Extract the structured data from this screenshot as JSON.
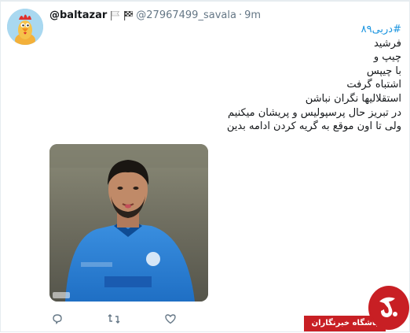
{
  "tweet": {
    "display_name": "@baltazar",
    "handle": "@27967499_savala",
    "separator": "·",
    "time": "9m",
    "text_lines": [
      {
        "text": "#دربی۸۹",
        "hashtag": true
      },
      {
        "text": "فرشید",
        "hashtag": false
      },
      {
        "text": "چیپ و",
        "hashtag": false
      },
      {
        "text": "با چیپس",
        "hashtag": false
      },
      {
        "text": "اشتباه گرفت",
        "hashtag": false
      },
      {
        "text": "استقلالیها نگران نباشن",
        "hashtag": false
      },
      {
        "text": "در تبریز حال پرسپولیس و پریشان میکنیم",
        "hashtag": false
      },
      {
        "text": "ولی تا اون موقع به گریه کردن ادامه بدین",
        "hashtag": false
      }
    ],
    "media": {
      "alt": "player photo"
    }
  },
  "actions": {
    "reply_icon": "reply-icon",
    "retweet_icon": "retweet-icon",
    "like_icon": "like-icon"
  },
  "watermark": {
    "label": "باشگاه خبرنگاران"
  },
  "colors": {
    "hashtag": "#1b95e0",
    "secondary": "#657786",
    "brand_red": "#c81f24"
  }
}
